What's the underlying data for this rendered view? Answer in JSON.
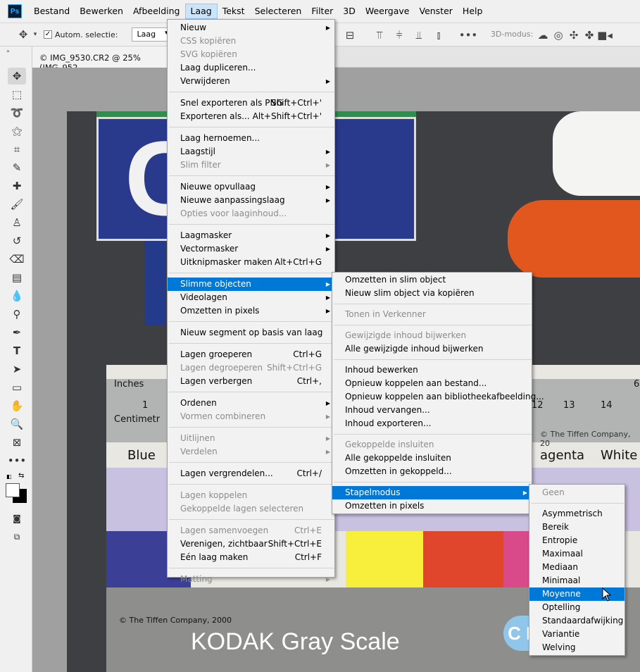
{
  "app": {
    "logo": "Ps"
  },
  "menubar": [
    "Bestand",
    "Bewerken",
    "Afbeelding",
    "Laag",
    "Tekst",
    "Selecteren",
    "Filter",
    "3D",
    "Weergave",
    "Venster",
    "Help"
  ],
  "options": {
    "auto_select_label": "Autom. selectie:",
    "auto_select_value": "Laag",
    "mode_3d": "3D-modus:"
  },
  "document": {
    "tab_title": "© IMG_9530.CR2 @ 25% (IMG_952"
  },
  "photo_text": {
    "letters": "CE",
    "inches": "Inches",
    "centimetres": "Centimetr",
    "ruler_num_1": "1",
    "ruler_12": "12",
    "ruler_13": "13",
    "ruler_14": "14",
    "ruler_6": "6",
    "copyright_small": "© The Tiffen Company, 20",
    "blue": "Blue",
    "agenta": "agenta",
    "white": "White",
    "copyright": "© The Tiffen Company, 2000",
    "kodak": "KODAK Gray Scale",
    "cm": "C M"
  },
  "layer_menu": {
    "items": [
      {
        "label": "Nieuw",
        "arrow": true
      },
      {
        "label": "CSS kopiëren",
        "disabled": true
      },
      {
        "label": "SVG kopiëren",
        "disabled": true
      },
      {
        "label": "Laag dupliceren..."
      },
      {
        "label": "Verwijderen",
        "arrow": true
      },
      {
        "sep": true
      },
      {
        "label": "Snel exporteren als PNG",
        "shortcut": "Shift+Ctrl+'"
      },
      {
        "label": "Exporteren als...",
        "shortcut": "Alt+Shift+Ctrl+'"
      },
      {
        "sep": true
      },
      {
        "label": "Laag hernoemen..."
      },
      {
        "label": "Laagstijl",
        "arrow": true
      },
      {
        "label": "Slim filter",
        "disabled": true,
        "arrow": true
      },
      {
        "sep": true
      },
      {
        "label": "Nieuwe opvullaag",
        "arrow": true
      },
      {
        "label": "Nieuwe aanpassingslaag",
        "arrow": true
      },
      {
        "label": "Opties voor laaginhoud...",
        "disabled": true
      },
      {
        "sep": true
      },
      {
        "label": "Laagmasker",
        "arrow": true
      },
      {
        "label": "Vectormasker",
        "arrow": true
      },
      {
        "label": "Uitknipmasker maken",
        "shortcut": "Alt+Ctrl+G"
      },
      {
        "sep": true
      },
      {
        "label": "Slimme objecten",
        "arrow": true,
        "highlight": true
      },
      {
        "label": "Videolagen",
        "arrow": true
      },
      {
        "label": "Omzetten in pixels",
        "arrow": true
      },
      {
        "sep": true
      },
      {
        "label": "Nieuw segment op basis van laag"
      },
      {
        "sep": true
      },
      {
        "label": "Lagen groeperen",
        "shortcut": "Ctrl+G"
      },
      {
        "label": "Lagen degroeperen",
        "shortcut": "Shift+Ctrl+G",
        "disabled": true
      },
      {
        "label": "Lagen verbergen",
        "shortcut": "Ctrl+,"
      },
      {
        "sep": true
      },
      {
        "label": "Ordenen",
        "arrow": true
      },
      {
        "label": "Vormen combineren",
        "arrow": true,
        "disabled": true
      },
      {
        "sep": true
      },
      {
        "label": "Uitlijnen",
        "arrow": true,
        "disabled": true
      },
      {
        "label": "Verdelen",
        "arrow": true,
        "disabled": true
      },
      {
        "sep": true
      },
      {
        "label": "Lagen vergrendelen...",
        "shortcut": "Ctrl+/"
      },
      {
        "sep": true
      },
      {
        "label": "Lagen koppelen",
        "disabled": true
      },
      {
        "label": "Gekoppelde lagen selecteren",
        "disabled": true
      },
      {
        "sep": true
      },
      {
        "label": "Lagen samenvoegen",
        "shortcut": "Ctrl+E",
        "disabled": true
      },
      {
        "label": "Verenigen, zichtbaar",
        "shortcut": "Shift+Ctrl+E"
      },
      {
        "label": "Eén laag maken",
        "shortcut": "Ctrl+F"
      },
      {
        "sep": true
      },
      {
        "label": "Matting",
        "arrow": true,
        "disabled": true
      }
    ]
  },
  "smart_menu": {
    "items": [
      {
        "label": "Omzetten in slim object"
      },
      {
        "label": "Nieuw slim object via kopiëren"
      },
      {
        "sep": true
      },
      {
        "label": "Tonen in Verkenner",
        "disabled": true
      },
      {
        "sep": true
      },
      {
        "label": "Gewijzigde inhoud bijwerken",
        "disabled": true
      },
      {
        "label": "Alle gewijzigde inhoud bijwerken"
      },
      {
        "sep": true
      },
      {
        "label": "Inhoud bewerken"
      },
      {
        "label": "Opnieuw koppelen aan bestand..."
      },
      {
        "label": "Opnieuw koppelen aan bibliotheekafbeelding..."
      },
      {
        "label": "Inhoud vervangen..."
      },
      {
        "label": "Inhoud exporteren..."
      },
      {
        "sep": true
      },
      {
        "label": "Gekoppelde insluiten",
        "disabled": true
      },
      {
        "label": "Alle gekoppelde insluiten"
      },
      {
        "label": "Omzetten in gekoppeld..."
      },
      {
        "sep": true
      },
      {
        "label": "Stapelmodus",
        "arrow": true,
        "highlight": true
      },
      {
        "label": "Omzetten in pixels"
      }
    ]
  },
  "stack_menu": {
    "items": [
      {
        "label": "Geen",
        "disabled": true
      },
      {
        "sep": true
      },
      {
        "label": "Asymmetrisch"
      },
      {
        "label": "Bereik"
      },
      {
        "label": "Entropie"
      },
      {
        "label": "Maximaal"
      },
      {
        "label": "Mediaan"
      },
      {
        "label": "Minimaal"
      },
      {
        "label": "Moyenne",
        "highlight": true
      },
      {
        "label": "Optelling"
      },
      {
        "label": "Standaardafwijking"
      },
      {
        "label": "Variantie"
      },
      {
        "label": "Welving"
      }
    ]
  }
}
